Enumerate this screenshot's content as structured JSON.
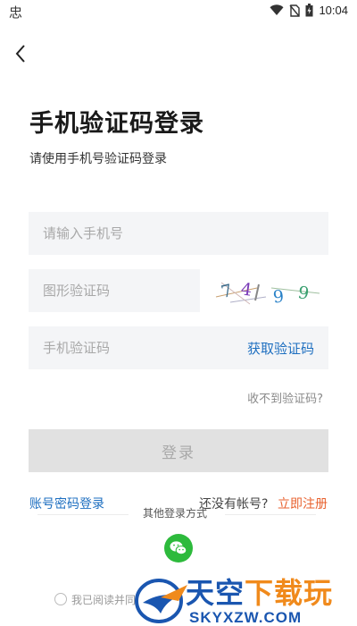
{
  "status_bar": {
    "app_icon_glyph": "忠",
    "time": "10:04"
  },
  "header": {
    "title": "手机验证码登录",
    "subtitle": "请使用手机号验证码登录"
  },
  "form": {
    "phone": {
      "value": "",
      "placeholder": "请输入手机号"
    },
    "captcha": {
      "value": "",
      "placeholder": "图形验证码",
      "image_text": "7 4 9 9"
    },
    "sms": {
      "value": "",
      "placeholder": "手机验证码",
      "get_code_label": "获取验证码"
    },
    "no_code_link": "收不到验证码?",
    "login_label": "登录"
  },
  "footer": {
    "password_login_label": "账号密码登录",
    "no_account_text": "还没有帐号?",
    "register_label": "立即注册",
    "other_login_label": "其他登录方式",
    "agree_text": "我已阅读并同意"
  },
  "watermark": {
    "cn_main": "天空",
    "cn_accent": "下载玩",
    "en": "SKYXZW.COM"
  },
  "colors": {
    "link_blue": "#1e6fc0",
    "register_orange": "#e8622f",
    "wechat_green": "#2dba3c",
    "input_bg": "#f4f5f7",
    "login_disabled_bg": "#e1e1e1"
  },
  "icons": {
    "back": "chevron-left-icon",
    "wifi": "wifi-icon",
    "no_sim": "no-sim-icon",
    "battery": "battery-icon",
    "wechat": "wechat-icon"
  }
}
